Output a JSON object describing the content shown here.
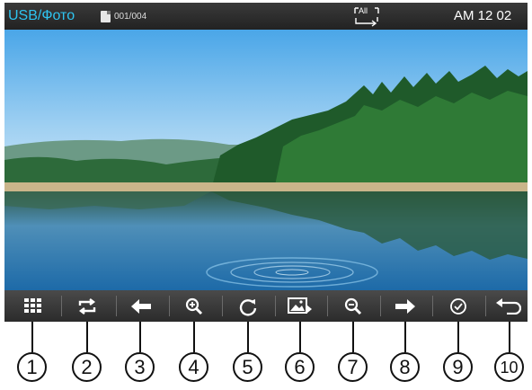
{
  "status_bar": {
    "source": "USB/Фото",
    "file_counter": "001/004",
    "repeat_mode": "All",
    "clock": "AM 12 02"
  },
  "photo": {
    "content": "lake-landscape-photo"
  },
  "toolbar": {
    "buttons": [
      {
        "icon": "grid-icon",
        "callout": "1"
      },
      {
        "icon": "repeat-icon",
        "callout": "2"
      },
      {
        "icon": "arrow-left-icon",
        "callout": "3"
      },
      {
        "icon": "zoom-in-icon",
        "callout": "4"
      },
      {
        "icon": "rotate-icon",
        "callout": "5"
      },
      {
        "icon": "slideshow-icon",
        "callout": "6"
      },
      {
        "icon": "zoom-out-icon",
        "callout": "7"
      },
      {
        "icon": "arrow-right-icon",
        "callout": "8"
      },
      {
        "icon": "checkmark-icon",
        "callout": "9"
      },
      {
        "icon": "back-icon",
        "callout": "10"
      }
    ]
  },
  "colors": {
    "source_label": "#2ec4f0",
    "toolbar_bg": "#3a3a3a",
    "icon": "#ffffff"
  }
}
